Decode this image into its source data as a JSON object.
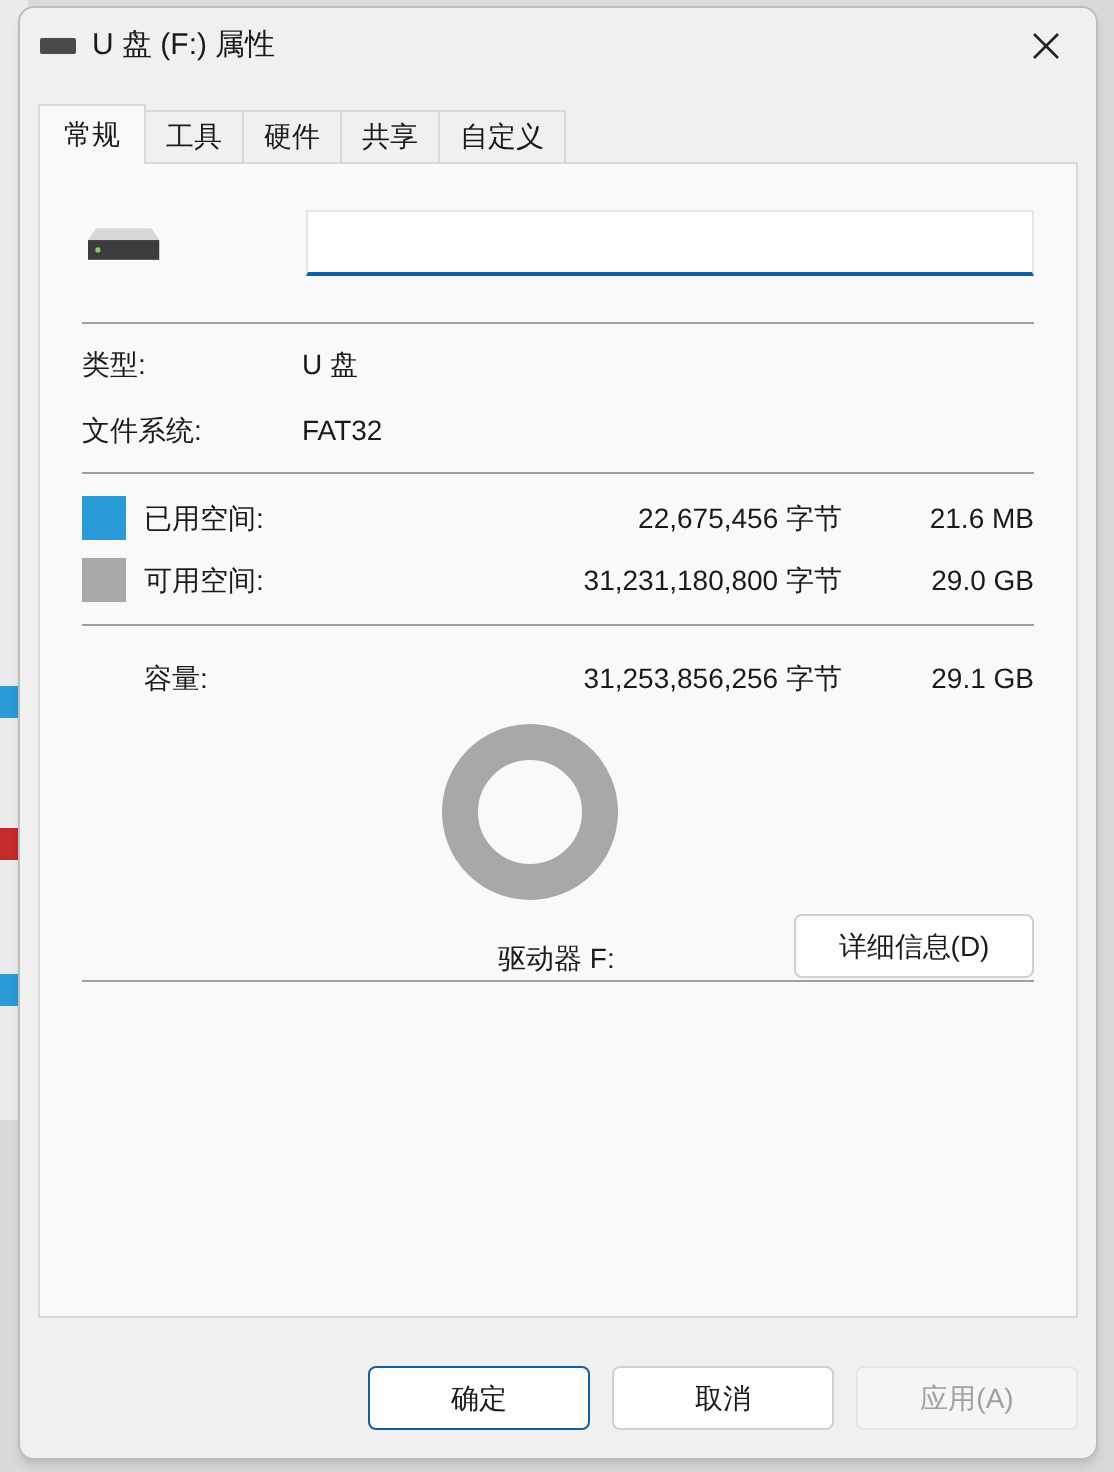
{
  "window": {
    "title": "U 盘 (F:) 属性"
  },
  "tabs": [
    {
      "label": "常规",
      "selected": true
    },
    {
      "label": "工具",
      "selected": false
    },
    {
      "label": "硬件",
      "selected": false
    },
    {
      "label": "共享",
      "selected": false
    },
    {
      "label": "自定义",
      "selected": false
    }
  ],
  "info": [
    {
      "label": "类型:",
      "value": "U 盘"
    },
    {
      "label": "文件系统:",
      "value": "FAT32"
    }
  ],
  "space": [
    {
      "label": "已用空间:",
      "bytes": "22,675,456 字节",
      "size": "21.6 MB",
      "color": "#2a9ad8"
    },
    {
      "label": "可用空间:",
      "bytes": "31,231,180,800 字节",
      "size": "29.0 GB",
      "color": "#a8a8a8"
    }
  ],
  "capacity": {
    "label": "容量:",
    "bytes": "31,253,856,256 字节",
    "size": "29.1 GB"
  },
  "drive_label": "驱动器 F:",
  "details_button": "详细信息(D)",
  "buttons": [
    {
      "label": "确定",
      "kind": "default",
      "disabled": false
    },
    {
      "label": "取消",
      "kind": "normal",
      "disabled": false
    },
    {
      "label": "应用(A)",
      "kind": "normal",
      "disabled": true
    }
  ]
}
